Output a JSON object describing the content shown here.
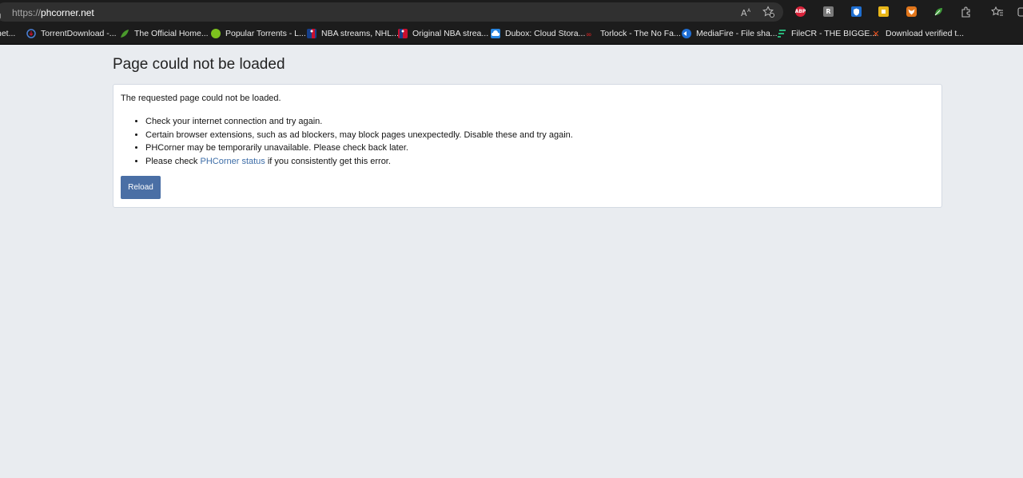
{
  "browser": {
    "url_scheme": "https://",
    "url_host": "phcorner.net",
    "toolbar_icons": [
      "read-aloud-icon",
      "add-favorite-icon",
      "extensions-icon",
      "favorites-icon",
      "collections-icon"
    ],
    "extensions": [
      {
        "name": "abp-extension-icon",
        "label": "ABP",
        "color": "#d9233a"
      },
      {
        "name": "r-extension-icon",
        "label": "R",
        "color": "#7a7a7a"
      },
      {
        "name": "shield-extension-icon",
        "label": "",
        "color": "#1f6fd1"
      },
      {
        "name": "yellow-extension-icon",
        "label": "",
        "color": "#e8b619"
      },
      {
        "name": "fox-extension-icon",
        "label": "",
        "color": "#e2761b"
      },
      {
        "name": "green-extension-icon",
        "label": "",
        "color": "#3f9a3a"
      }
    ]
  },
  "bookmarks": [
    {
      "label": "net...",
      "icon": "generic-favicon",
      "color": "#555555"
    },
    {
      "label": "TorrentDownload -...",
      "icon": "torrentdownload-favicon",
      "color": "#4a7fd6"
    },
    {
      "label": "The Official Home...",
      "icon": "leaf-favicon",
      "color": "#4a9a2c"
    },
    {
      "label": "Popular Torrents - L...",
      "icon": "ball-favicon",
      "color": "#7dc21e"
    },
    {
      "label": "NBA streams, NHL...",
      "icon": "nba-favicon",
      "color": "#c8102e"
    },
    {
      "label": "Original NBA strea...",
      "icon": "nba-favicon",
      "color": "#c8102e"
    },
    {
      "label": "Dubox: Cloud Stora...",
      "icon": "cloud-favicon",
      "color": "#2a86e0"
    },
    {
      "label": "Torlock - The No Fa...",
      "icon": "torlock-favicon",
      "color": "#b22222"
    },
    {
      "label": "MediaFire - File sha...",
      "icon": "mediafire-favicon",
      "color": "#1f6ed4"
    },
    {
      "label": "FileCR - THE BIGGE...",
      "icon": "filecr-favicon",
      "color": "#29b67a"
    },
    {
      "label": "Download verified t...",
      "icon": "x-favicon",
      "color": "#e8501e"
    }
  ],
  "page": {
    "title": "Page could not be loaded",
    "intro": "The requested page could not be loaded.",
    "reasons": [
      "Check your internet connection and try again.",
      "Certain browser extensions, such as ad blockers, may block pages unexpectedly. Disable these and try again.",
      "PHCorner may be temporarily unavailable. Please check back later."
    ],
    "status_prefix": "Please check ",
    "status_link": "PHCorner status",
    "status_suffix": " if you consistently get this error.",
    "reload_label": "Reload"
  }
}
